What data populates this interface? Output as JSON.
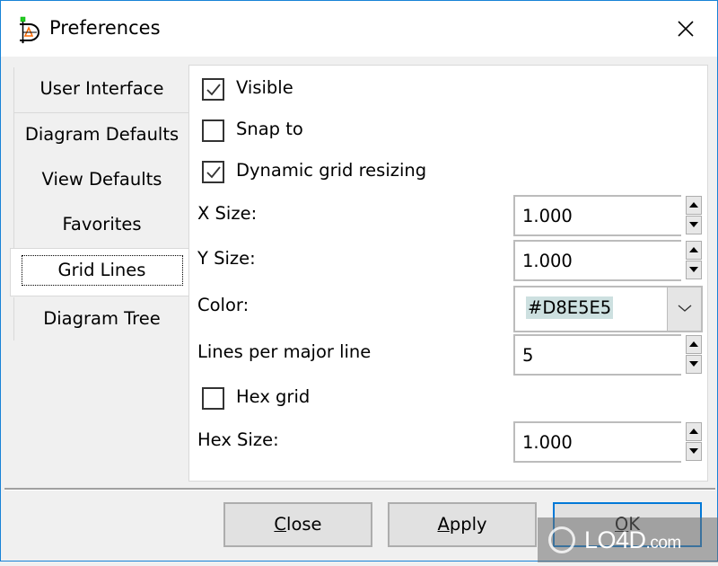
{
  "window": {
    "title": "Preferences",
    "app_icon": "drawing-app-icon",
    "close_icon": "close-icon"
  },
  "tabs": [
    {
      "label": "User Interface",
      "active": false
    },
    {
      "label": "Diagram Defaults",
      "active": false
    },
    {
      "label": "View Defaults",
      "active": false
    },
    {
      "label": "Favorites",
      "active": false
    },
    {
      "label": "Grid Lines",
      "active": true
    },
    {
      "label": "Diagram Tree",
      "active": false
    }
  ],
  "grid_lines": {
    "visible": {
      "label": "Visible",
      "checked": true
    },
    "snap_to": {
      "label": "Snap to",
      "checked": false
    },
    "dynamic_resizing": {
      "label": "Dynamic grid resizing",
      "checked": true
    },
    "x_size": {
      "label": "X Size:",
      "value": "1.000"
    },
    "y_size": {
      "label": "Y Size:",
      "value": "1.000"
    },
    "color": {
      "label": "Color:",
      "value": "#D8E5E5"
    },
    "lines_per_major": {
      "label": "Lines per major line",
      "value": "5"
    },
    "hex_grid": {
      "label": "Hex grid",
      "checked": false
    },
    "hex_size": {
      "label": "Hex Size:",
      "value": "1.000"
    }
  },
  "footer": {
    "close": {
      "mnemonic": "C",
      "rest": "lose"
    },
    "apply": {
      "mnemonic": "A",
      "rest": "pply"
    },
    "ok": {
      "mnemonic": "O",
      "rest": "K"
    }
  },
  "watermark": {
    "brand": "LO4D",
    "suffix": ".com"
  },
  "colors": {
    "accent": "#0078d7",
    "window_border": "#1883d7",
    "selection": "#cde0e0"
  }
}
